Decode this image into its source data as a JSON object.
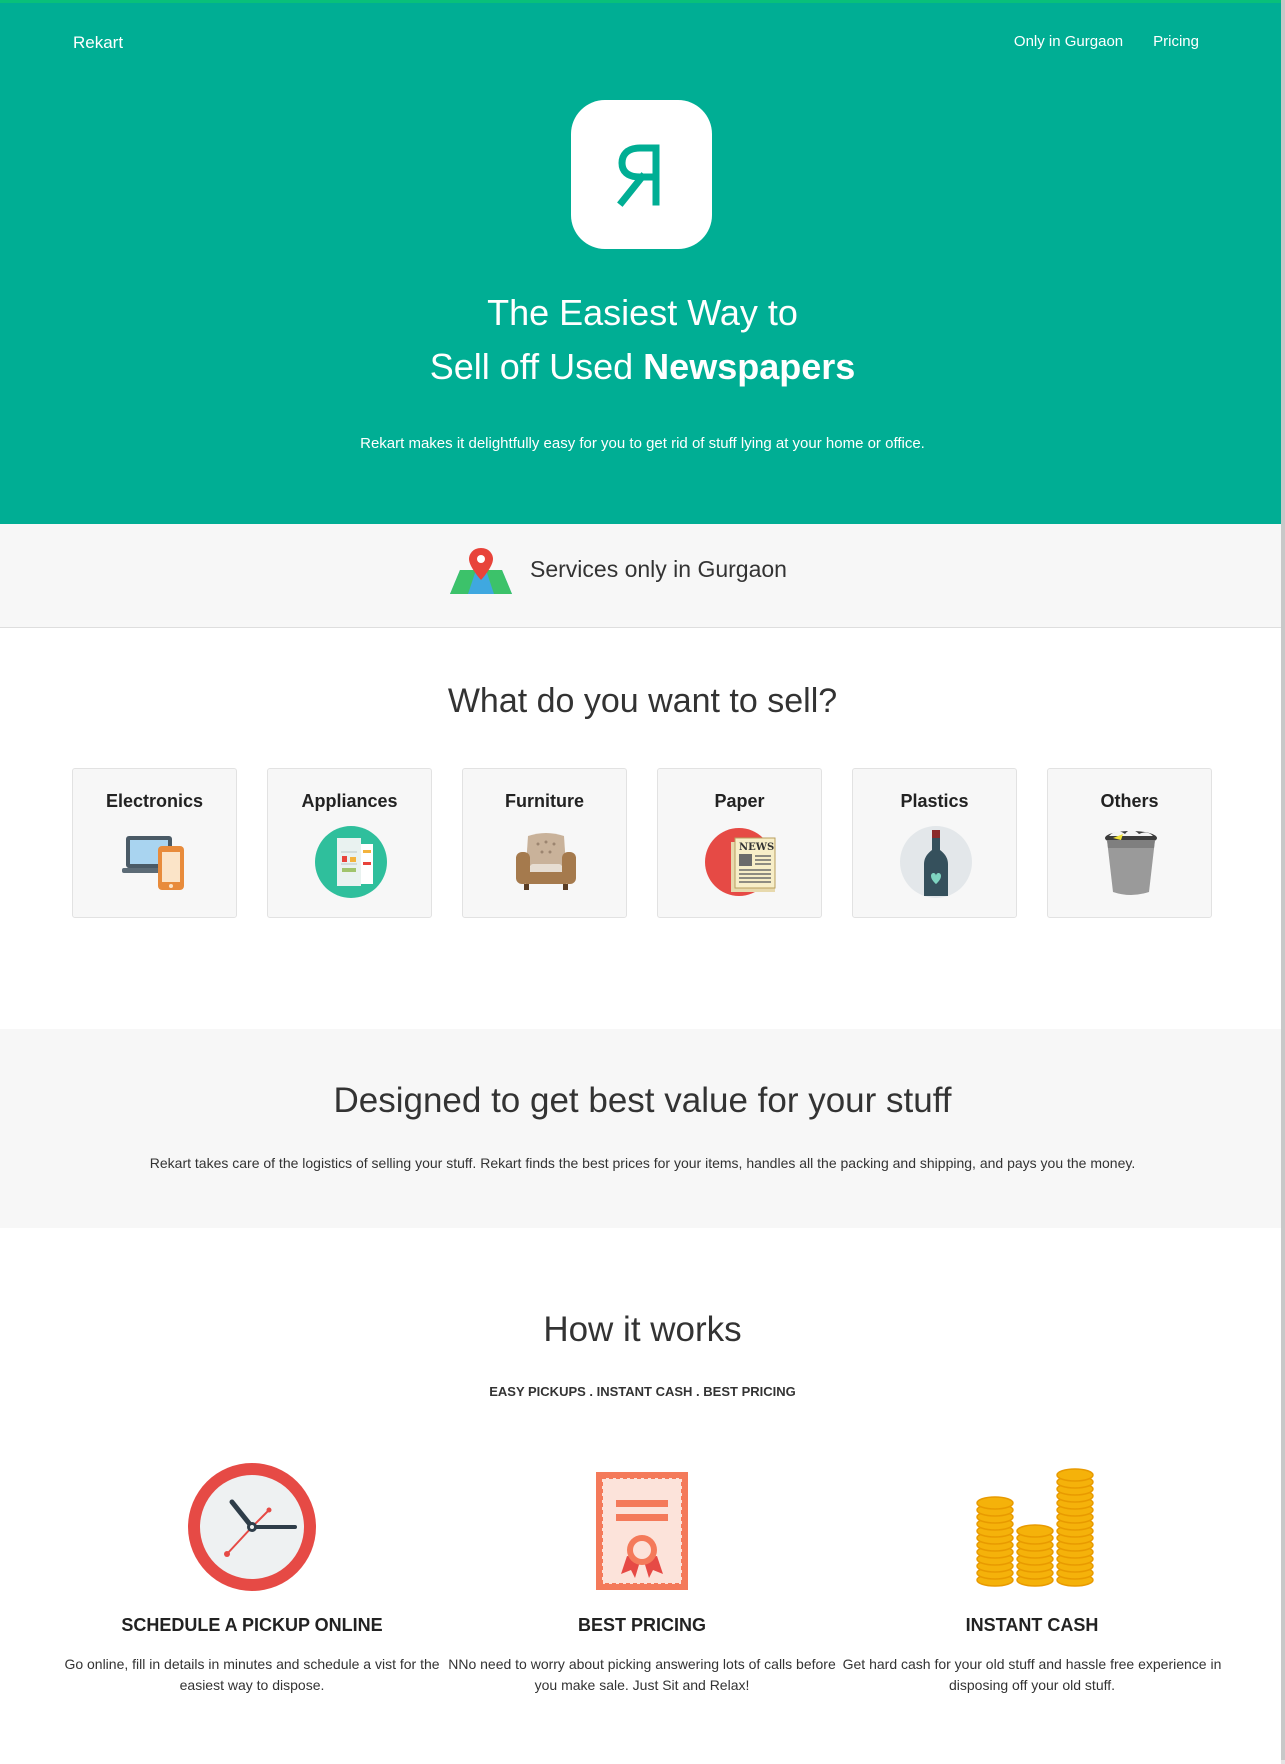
{
  "header": {
    "brand": "Rekart",
    "nav": [
      "Only in Gurgaon",
      "Pricing"
    ],
    "logo_glyph": "Я"
  },
  "hero": {
    "title_line1": "The Easiest Way to",
    "title_line2_prefix": "Sell off Used ",
    "title_line2_bold": "Newspapers",
    "subtitle": "Rekart makes it delightfully easy for you to get rid of stuff lying at your home or office."
  },
  "services": {
    "icon": "map-pin-icon",
    "text": "Services only in Gurgaon"
  },
  "sell": {
    "title": "What do you want to sell?",
    "categories": [
      {
        "label": "Electronics",
        "icon": "electronics-icon"
      },
      {
        "label": "Appliances",
        "icon": "fridge-icon"
      },
      {
        "label": "Furniture",
        "icon": "armchair-icon"
      },
      {
        "label": "Paper",
        "icon": "newspaper-icon"
      },
      {
        "label": "Plastics",
        "icon": "bottle-icon"
      },
      {
        "label": "Others",
        "icon": "bin-icon"
      }
    ]
  },
  "designed": {
    "title": "Designed to get best value for your stuff",
    "text": "Rekart takes care of the logistics of selling your stuff. Rekart finds the best prices for your items, handles all the packing and shipping, and pays you the money."
  },
  "how": {
    "title": "How it works",
    "subtitle": "EASY PICKUPS . INSTANT CASH . BEST PRICING",
    "features": [
      {
        "title": "SCHEDULE A PICKUP ONLINE",
        "text": "Go online, fill in details in minutes and schedule a vist for the easiest way to dispose.",
        "icon": "clock-icon"
      },
      {
        "title": "BEST PRICING",
        "text": "NNo need to worry about picking answering lots of calls before you make sale. Just Sit and Relax!",
        "icon": "certificate-icon"
      },
      {
        "title": "INSTANT CASH",
        "text": "Get hard cash for your old stuff and hassle free experience in disposing off your old stuff.",
        "icon": "coins-icon"
      }
    ]
  },
  "colors": {
    "brand_green": "#00ae94",
    "light_section": "#f7f7f7"
  }
}
